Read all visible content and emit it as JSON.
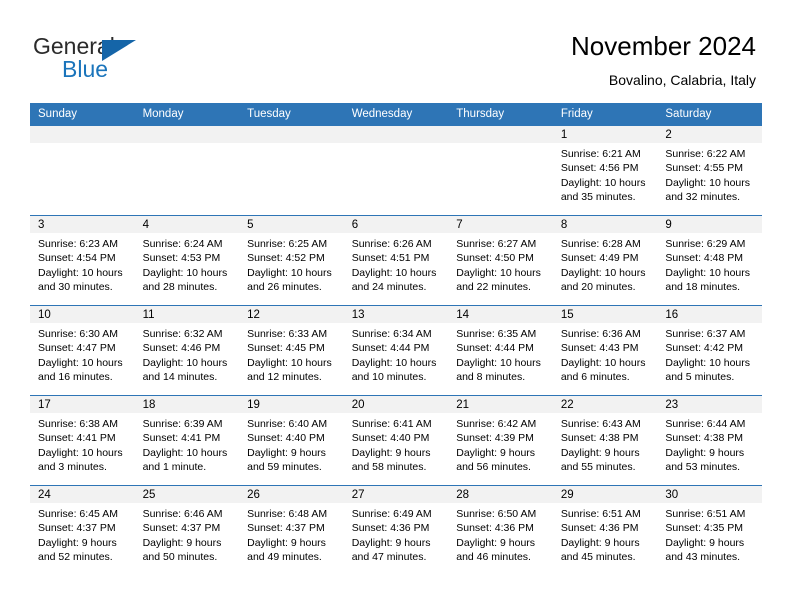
{
  "brand": {
    "word_general": "General",
    "word_blue": "Blue",
    "logo_icon": "triangle-logo-icon"
  },
  "header": {
    "title": "November 2024",
    "subtitle": "Bovalino, Calabria, Italy"
  },
  "colors": {
    "header_blue": "#2e75b6",
    "brand_blue": "#1a74bb",
    "daynum_band": "#f2f2f2",
    "text": "#000000"
  },
  "weekday_headers": [
    "Sunday",
    "Monday",
    "Tuesday",
    "Wednesday",
    "Thursday",
    "Friday",
    "Saturday"
  ],
  "weeks": [
    [
      {
        "day": "",
        "sunrise": "",
        "sunset": "",
        "daylight1": "",
        "daylight2": ""
      },
      {
        "day": "",
        "sunrise": "",
        "sunset": "",
        "daylight1": "",
        "daylight2": ""
      },
      {
        "day": "",
        "sunrise": "",
        "sunset": "",
        "daylight1": "",
        "daylight2": ""
      },
      {
        "day": "",
        "sunrise": "",
        "sunset": "",
        "daylight1": "",
        "daylight2": ""
      },
      {
        "day": "",
        "sunrise": "",
        "sunset": "",
        "daylight1": "",
        "daylight2": ""
      },
      {
        "day": "1",
        "sunrise": "Sunrise: 6:21 AM",
        "sunset": "Sunset: 4:56 PM",
        "daylight1": "Daylight: 10 hours",
        "daylight2": "and 35 minutes."
      },
      {
        "day": "2",
        "sunrise": "Sunrise: 6:22 AM",
        "sunset": "Sunset: 4:55 PM",
        "daylight1": "Daylight: 10 hours",
        "daylight2": "and 32 minutes."
      }
    ],
    [
      {
        "day": "3",
        "sunrise": "Sunrise: 6:23 AM",
        "sunset": "Sunset: 4:54 PM",
        "daylight1": "Daylight: 10 hours",
        "daylight2": "and 30 minutes."
      },
      {
        "day": "4",
        "sunrise": "Sunrise: 6:24 AM",
        "sunset": "Sunset: 4:53 PM",
        "daylight1": "Daylight: 10 hours",
        "daylight2": "and 28 minutes."
      },
      {
        "day": "5",
        "sunrise": "Sunrise: 6:25 AM",
        "sunset": "Sunset: 4:52 PM",
        "daylight1": "Daylight: 10 hours",
        "daylight2": "and 26 minutes."
      },
      {
        "day": "6",
        "sunrise": "Sunrise: 6:26 AM",
        "sunset": "Sunset: 4:51 PM",
        "daylight1": "Daylight: 10 hours",
        "daylight2": "and 24 minutes."
      },
      {
        "day": "7",
        "sunrise": "Sunrise: 6:27 AM",
        "sunset": "Sunset: 4:50 PM",
        "daylight1": "Daylight: 10 hours",
        "daylight2": "and 22 minutes."
      },
      {
        "day": "8",
        "sunrise": "Sunrise: 6:28 AM",
        "sunset": "Sunset: 4:49 PM",
        "daylight1": "Daylight: 10 hours",
        "daylight2": "and 20 minutes."
      },
      {
        "day": "9",
        "sunrise": "Sunrise: 6:29 AM",
        "sunset": "Sunset: 4:48 PM",
        "daylight1": "Daylight: 10 hours",
        "daylight2": "and 18 minutes."
      }
    ],
    [
      {
        "day": "10",
        "sunrise": "Sunrise: 6:30 AM",
        "sunset": "Sunset: 4:47 PM",
        "daylight1": "Daylight: 10 hours",
        "daylight2": "and 16 minutes."
      },
      {
        "day": "11",
        "sunrise": "Sunrise: 6:32 AM",
        "sunset": "Sunset: 4:46 PM",
        "daylight1": "Daylight: 10 hours",
        "daylight2": "and 14 minutes."
      },
      {
        "day": "12",
        "sunrise": "Sunrise: 6:33 AM",
        "sunset": "Sunset: 4:45 PM",
        "daylight1": "Daylight: 10 hours",
        "daylight2": "and 12 minutes."
      },
      {
        "day": "13",
        "sunrise": "Sunrise: 6:34 AM",
        "sunset": "Sunset: 4:44 PM",
        "daylight1": "Daylight: 10 hours",
        "daylight2": "and 10 minutes."
      },
      {
        "day": "14",
        "sunrise": "Sunrise: 6:35 AM",
        "sunset": "Sunset: 4:44 PM",
        "daylight1": "Daylight: 10 hours",
        "daylight2": "and 8 minutes."
      },
      {
        "day": "15",
        "sunrise": "Sunrise: 6:36 AM",
        "sunset": "Sunset: 4:43 PM",
        "daylight1": "Daylight: 10 hours",
        "daylight2": "and 6 minutes."
      },
      {
        "day": "16",
        "sunrise": "Sunrise: 6:37 AM",
        "sunset": "Sunset: 4:42 PM",
        "daylight1": "Daylight: 10 hours",
        "daylight2": "and 5 minutes."
      }
    ],
    [
      {
        "day": "17",
        "sunrise": "Sunrise: 6:38 AM",
        "sunset": "Sunset: 4:41 PM",
        "daylight1": "Daylight: 10 hours",
        "daylight2": "and 3 minutes."
      },
      {
        "day": "18",
        "sunrise": "Sunrise: 6:39 AM",
        "sunset": "Sunset: 4:41 PM",
        "daylight1": "Daylight: 10 hours",
        "daylight2": "and 1 minute."
      },
      {
        "day": "19",
        "sunrise": "Sunrise: 6:40 AM",
        "sunset": "Sunset: 4:40 PM",
        "daylight1": "Daylight: 9 hours",
        "daylight2": "and 59 minutes."
      },
      {
        "day": "20",
        "sunrise": "Sunrise: 6:41 AM",
        "sunset": "Sunset: 4:40 PM",
        "daylight1": "Daylight: 9 hours",
        "daylight2": "and 58 minutes."
      },
      {
        "day": "21",
        "sunrise": "Sunrise: 6:42 AM",
        "sunset": "Sunset: 4:39 PM",
        "daylight1": "Daylight: 9 hours",
        "daylight2": "and 56 minutes."
      },
      {
        "day": "22",
        "sunrise": "Sunrise: 6:43 AM",
        "sunset": "Sunset: 4:38 PM",
        "daylight1": "Daylight: 9 hours",
        "daylight2": "and 55 minutes."
      },
      {
        "day": "23",
        "sunrise": "Sunrise: 6:44 AM",
        "sunset": "Sunset: 4:38 PM",
        "daylight1": "Daylight: 9 hours",
        "daylight2": "and 53 minutes."
      }
    ],
    [
      {
        "day": "24",
        "sunrise": "Sunrise: 6:45 AM",
        "sunset": "Sunset: 4:37 PM",
        "daylight1": "Daylight: 9 hours",
        "daylight2": "and 52 minutes."
      },
      {
        "day": "25",
        "sunrise": "Sunrise: 6:46 AM",
        "sunset": "Sunset: 4:37 PM",
        "daylight1": "Daylight: 9 hours",
        "daylight2": "and 50 minutes."
      },
      {
        "day": "26",
        "sunrise": "Sunrise: 6:48 AM",
        "sunset": "Sunset: 4:37 PM",
        "daylight1": "Daylight: 9 hours",
        "daylight2": "and 49 minutes."
      },
      {
        "day": "27",
        "sunrise": "Sunrise: 6:49 AM",
        "sunset": "Sunset: 4:36 PM",
        "daylight1": "Daylight: 9 hours",
        "daylight2": "and 47 minutes."
      },
      {
        "day": "28",
        "sunrise": "Sunrise: 6:50 AM",
        "sunset": "Sunset: 4:36 PM",
        "daylight1": "Daylight: 9 hours",
        "daylight2": "and 46 minutes."
      },
      {
        "day": "29",
        "sunrise": "Sunrise: 6:51 AM",
        "sunset": "Sunset: 4:36 PM",
        "daylight1": "Daylight: 9 hours",
        "daylight2": "and 45 minutes."
      },
      {
        "day": "30",
        "sunrise": "Sunrise: 6:51 AM",
        "sunset": "Sunset: 4:35 PM",
        "daylight1": "Daylight: 9 hours",
        "daylight2": "and 43 minutes."
      }
    ]
  ]
}
